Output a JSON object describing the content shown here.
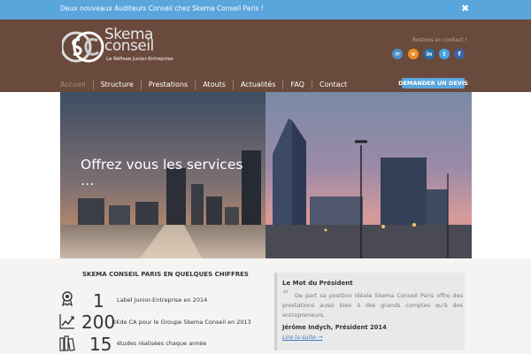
{
  "topbar": {
    "message": "Deux nouveaux Auditeurs Conseil chez Skema Conseil Paris !",
    "close_icon": "✖"
  },
  "header": {
    "logo": {
      "word_line1": "Skema",
      "word_line2": "conseil",
      "tagline": "Le Réflexe Junior-Entreprise"
    },
    "contact_label": "Restons en contact !",
    "social": [
      {
        "name": "mail-icon",
        "glyph": "✉"
      },
      {
        "name": "viadeo-icon",
        "glyph": "v"
      },
      {
        "name": "linkedin-icon",
        "glyph": "in"
      },
      {
        "name": "twitter-icon",
        "glyph": "t"
      },
      {
        "name": "facebook-icon",
        "glyph": "f"
      }
    ],
    "nav": [
      "Accueil",
      "Structure",
      "Prestations",
      "Atouts",
      "Actualités",
      "FAQ",
      "Contact"
    ],
    "cta_label": "DEMANDER UN DEVIS"
  },
  "hero": {
    "title": "Offrez vous les services …"
  },
  "figures": {
    "title": "SKEMA CONSEIL PARIS EN QUELQUES CHIFFRES",
    "items": [
      {
        "icon": "award-icon",
        "number": "1",
        "label": "Label Junior-Entreprise en 2014"
      },
      {
        "icon": "growth-chart-icon",
        "number": "200",
        "label": "K€de CA pour le Groupe Skema Conseil en 2013"
      },
      {
        "icon": "books-icon",
        "number": "15",
        "label": "études réalisées chaque année"
      }
    ]
  },
  "president": {
    "title": "Le Mot du Président",
    "quote_mark": "“",
    "text": "De part sa position idéale Skema Conseil Paris offre des prestations aussi bien à des grands comptes qu'à des entrepreneurs.",
    "signature": "Jérôme Indych, Président 2014",
    "link": "Lire la suite →"
  },
  "colors": {
    "accent": "#5aa5dc",
    "header_brown": "#6a4a3c"
  }
}
